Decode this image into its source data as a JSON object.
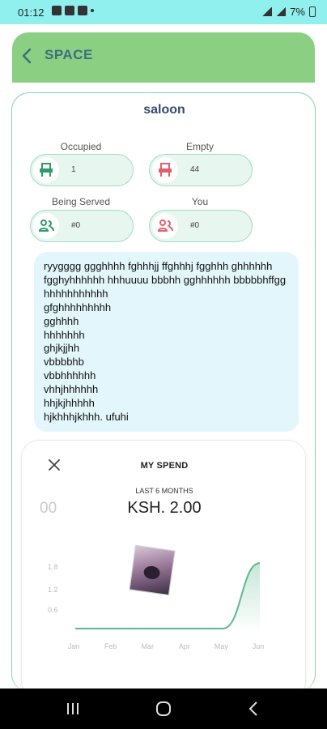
{
  "status_bar": {
    "time": "01:12",
    "battery": "7%"
  },
  "app_bar": {
    "title": "SPACE"
  },
  "card": {
    "name": "saloon",
    "stats": [
      {
        "label": "Occupied",
        "value": "1",
        "icon": "seat-icon"
      },
      {
        "label": "Empty",
        "value": "44",
        "icon": "seat-icon"
      },
      {
        "label": "Being Served",
        "value": "#0",
        "icon": "people-icon"
      },
      {
        "label": "You",
        "value": "#0",
        "icon": "people-icon"
      }
    ],
    "notes": "ryygggg ggghhhh fghhhjj ffghhhj fgghhh ghhhhhh fgghyhhhhhh hhhuuuu bbbhh gghhhhhh bbbbbhffgg hhhhhhhhhhh\ngfghhhhhhhhh\ngghhhh\nhhhhhhh\nghjkjjhh\nvbbbbhb\nvbbhhhhhh\nvhhjhhhhhh\nhhjkjhhhhh\nhjkhhhjkhhh.        ufuhi"
  },
  "spend": {
    "title": "MY SPEND",
    "subtitle": "LAST 6 MONTHS",
    "amount": "KSH. 2.00",
    "left_value": "00"
  },
  "chart_data": {
    "type": "area",
    "categories": [
      "Jan",
      "Feb",
      "Mar",
      "Apr",
      "May",
      "Jun"
    ],
    "values": [
      0,
      0,
      0,
      0,
      0,
      2.0
    ],
    "yticks": [
      "1.8",
      "1.2",
      "0.6"
    ],
    "ylim": [
      0,
      2.4
    ],
    "grid": false,
    "color": "#5cb98d"
  }
}
